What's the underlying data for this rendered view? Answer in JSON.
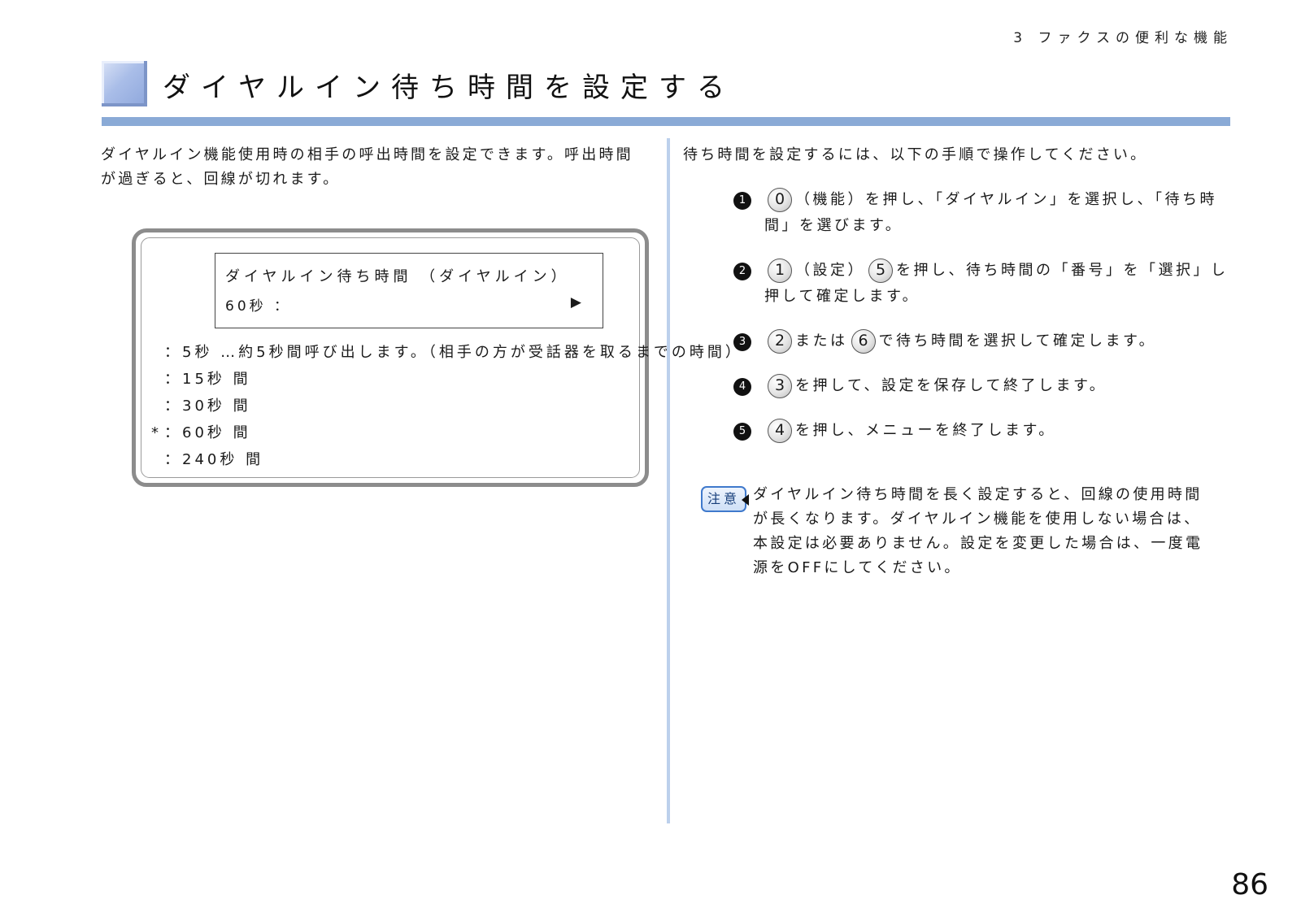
{
  "header": {
    "chapter": "3 ファクスの便利な機能"
  },
  "section": {
    "title": "ダイヤルイン待ち時間を設定する"
  },
  "left": {
    "intro": "ダイヤルイン機能使用時の相手の呼出時間を設定できます。呼出時間が過ぎると、回線が切れます。",
    "display": {
      "line1": "ダイヤルイン待ち時間 （ダイヤルイン）",
      "line2": "60秒 ：",
      "cursor": "▶"
    },
    "options": [
      {
        "marker": "",
        "text": "：5秒 …約5秒間呼び出します。（相手の方が受話器を取るまでの時間）"
      },
      {
        "marker": "",
        "text": "：15秒 間"
      },
      {
        "marker": "",
        "text": "：30秒 間"
      },
      {
        "marker": "*",
        "text": "：60秒 間"
      },
      {
        "marker": "",
        "text": "：240秒 間"
      }
    ]
  },
  "right": {
    "intro": "待ち時間を設定するには、以下の手順で操作してください。",
    "steps": [
      {
        "marker": "1",
        "before": "",
        "key1": "0",
        "middle": "（機能）を押し、「ダイヤルイン」を選択し、「待ち時間」を選びます。",
        "key2": "",
        "after": ""
      },
      {
        "marker": "2",
        "before": "",
        "key1": "1",
        "middle": "（設定）",
        "key2": "5",
        "after": "を押し、待ち時間の「番号」を「選択」し押して確定します。"
      },
      {
        "marker": "3",
        "before": "",
        "key1": "2",
        "middle": "または",
        "key2": "6",
        "after": "で待ち時間を選択して確定します。"
      },
      {
        "marker": "4",
        "before": "",
        "key1": "3",
        "middle": "を押して、設定を保存して終了します。",
        "key2": "",
        "after": ""
      },
      {
        "marker": "5",
        "before": "",
        "key1": "4",
        "middle": "を押し、メニューを終了します。",
        "key2": "",
        "after": ""
      }
    ],
    "note": {
      "badge": "注意",
      "text": "ダイヤルイン待ち時間を長く設定すると、回線の使用時間が長くなります。ダイヤルイン機能を使用しない場合は、本設定は必要ありません。設定を変更した場合は、一度電源をOFFにしてください。"
    }
  },
  "footer": {
    "page_number": "86"
  }
}
